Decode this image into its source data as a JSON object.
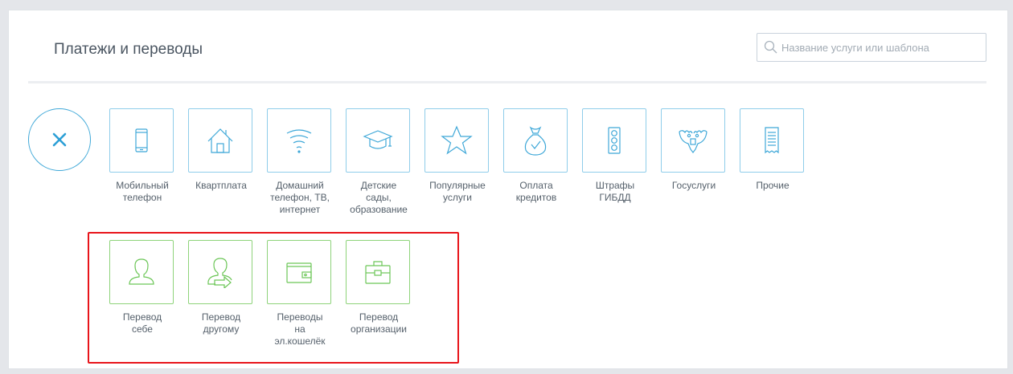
{
  "header": {
    "title": "Платежи и переводы",
    "search_placeholder": "Название услуги или шаблона"
  },
  "categories": [
    {
      "label": "Мобильный\nтелефон",
      "icon": "mobile-phone-icon"
    },
    {
      "label": "Квартплата",
      "icon": "house-icon"
    },
    {
      "label": "Домашний\nтелефон, ТВ,\nинтернет",
      "icon": "wifi-icon"
    },
    {
      "label": "Детские\nсады,\nобразование",
      "icon": "graduation-cap-icon"
    },
    {
      "label": "Популярные\nуслуги",
      "icon": "star-icon"
    },
    {
      "label": "Оплата\nкредитов",
      "icon": "money-bag-icon"
    },
    {
      "label": "Штрафы\nГИБДД",
      "icon": "traffic-light-icon"
    },
    {
      "label": "Госуслуги",
      "icon": "eagle-emblem-icon"
    },
    {
      "label": "Прочие",
      "icon": "receipt-icon"
    }
  ],
  "transfers": [
    {
      "label": "Перевод\nсебе",
      "icon": "person-icon"
    },
    {
      "label": "Перевод\nдругому",
      "icon": "person-transfer-icon"
    },
    {
      "label": "Переводы\nна\nэл.кошелёк",
      "icon": "wallet-icon"
    },
    {
      "label": "Перевод\nорганизации",
      "icon": "briefcase-icon"
    }
  ],
  "colors": {
    "accent_blue": "#3fa8d8",
    "accent_green": "#6cc657",
    "highlight_red": "#e8141a"
  }
}
